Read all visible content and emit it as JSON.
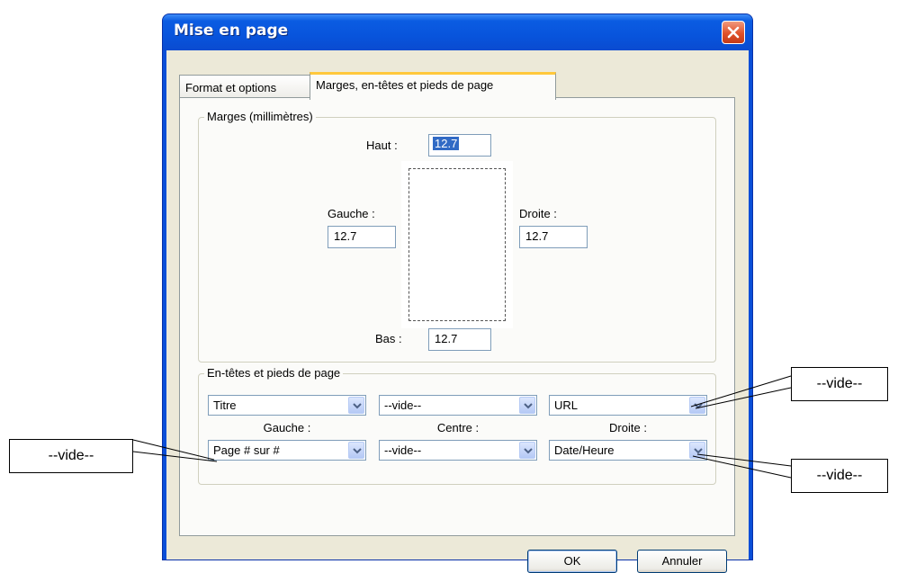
{
  "window": {
    "title": "Mise en page"
  },
  "tabs": [
    {
      "label": "Format et options"
    },
    {
      "label": "Marges, en-têtes et pieds de page"
    }
  ],
  "margins": {
    "group_label": "Marges (millimètres)",
    "top_label": "Haut :",
    "top_value": "12.7",
    "left_label": "Gauche :",
    "left_value": "12.7",
    "right_label": "Droite :",
    "right_value": "12.7",
    "bottom_label": "Bas :",
    "bottom_value": "12.7"
  },
  "headers_footers": {
    "group_label": "En-têtes et pieds de page",
    "header": {
      "left": "Titre",
      "center": "--vide--",
      "right": "URL"
    },
    "column_labels": {
      "left": "Gauche :",
      "center": "Centre :",
      "right": "Droite :"
    },
    "footer": {
      "left": "Page # sur #",
      "center": "--vide--",
      "right": "Date/Heure"
    }
  },
  "buttons": {
    "ok": "OK",
    "cancel": "Annuler"
  },
  "callouts": {
    "top_right": "--vide--",
    "left": "--vide--",
    "bottom_right": "--vide--"
  },
  "icons": [
    "close-icon",
    "dropdown-arrow-icon"
  ],
  "colors": {
    "titlebar": "#0854dc",
    "close_button": "#e0512a",
    "dialog_bg": "#ece9d8"
  }
}
